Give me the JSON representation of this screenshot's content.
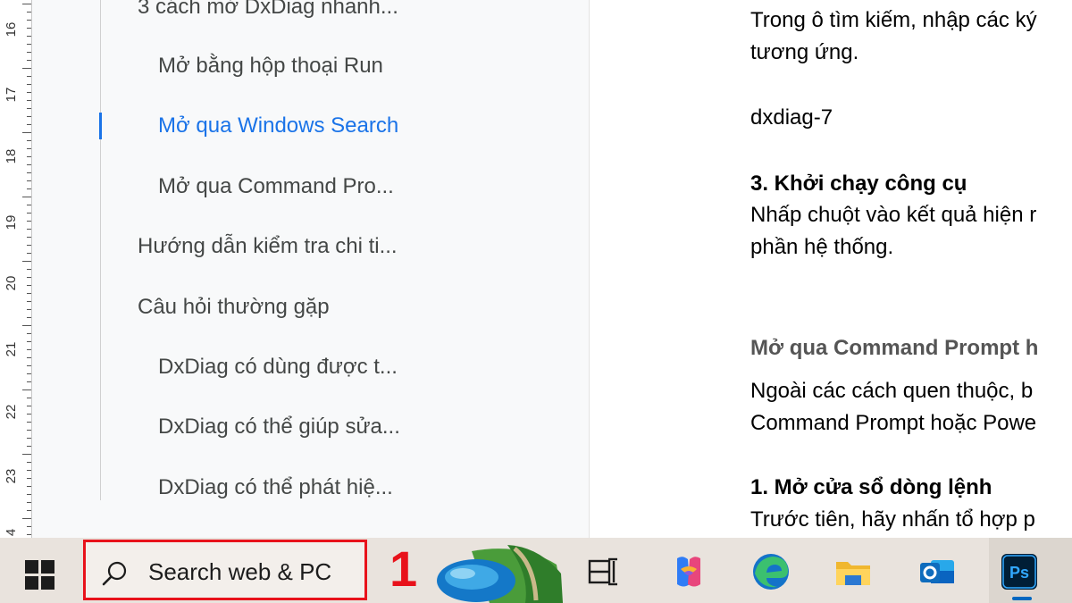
{
  "ruler": {
    "numbers": [
      "16",
      "17",
      "18",
      "19",
      "20",
      "21",
      "22",
      "23",
      "4"
    ]
  },
  "outline": {
    "items": [
      {
        "label": "3 cách mở DxDiag nhanh...",
        "level": 1,
        "active": false
      },
      {
        "label": "Mở bằng hộp thoại Run",
        "level": 2,
        "active": false
      },
      {
        "label": "Mở qua Windows Search",
        "level": 2,
        "active": true
      },
      {
        "label": "Mở qua Command Pro...",
        "level": 2,
        "active": false
      },
      {
        "label": "Hướng dẫn kiểm tra chi ti...",
        "level": 1,
        "active": false
      },
      {
        "label": "Câu hỏi thường gặp",
        "level": 1,
        "active": false
      },
      {
        "label": "DxDiag có dùng được t...",
        "level": 2,
        "active": false
      },
      {
        "label": "DxDiag có thể giúp sửa...",
        "level": 2,
        "active": false
      },
      {
        "label": "DxDiag có thể phát hiệ...",
        "level": 2,
        "active": false
      }
    ],
    "active_color": "#1a73e8"
  },
  "document": {
    "lines": [
      "Trong ô tìm kiếm, nhập các ký",
      "tương ứng.",
      "dxdiag-7",
      "3. Khởi chạy công cụ",
      "Nhấp chuột vào kết quả hiện r",
      "phần hệ thống.",
      "Mở qua Command Prompt h",
      "Ngoài các cách quen thuộc, b",
      "Command Prompt hoặc Powe",
      "1. Mở cửa sổ dòng lệnh",
      "Trước tiên, hãy nhấn tổ hợp p"
    ]
  },
  "taskbar": {
    "search_label": "Search web & PC",
    "annotation_number": "1",
    "annotation_color": "#e8121b",
    "icons": [
      "windows-start-icon",
      "search-icon",
      "task-view-icon",
      "copilot-icon",
      "edge-icon",
      "file-explorer-icon",
      "outlook-icon",
      "photoshop-icon"
    ],
    "photoshop_label": "Ps"
  }
}
